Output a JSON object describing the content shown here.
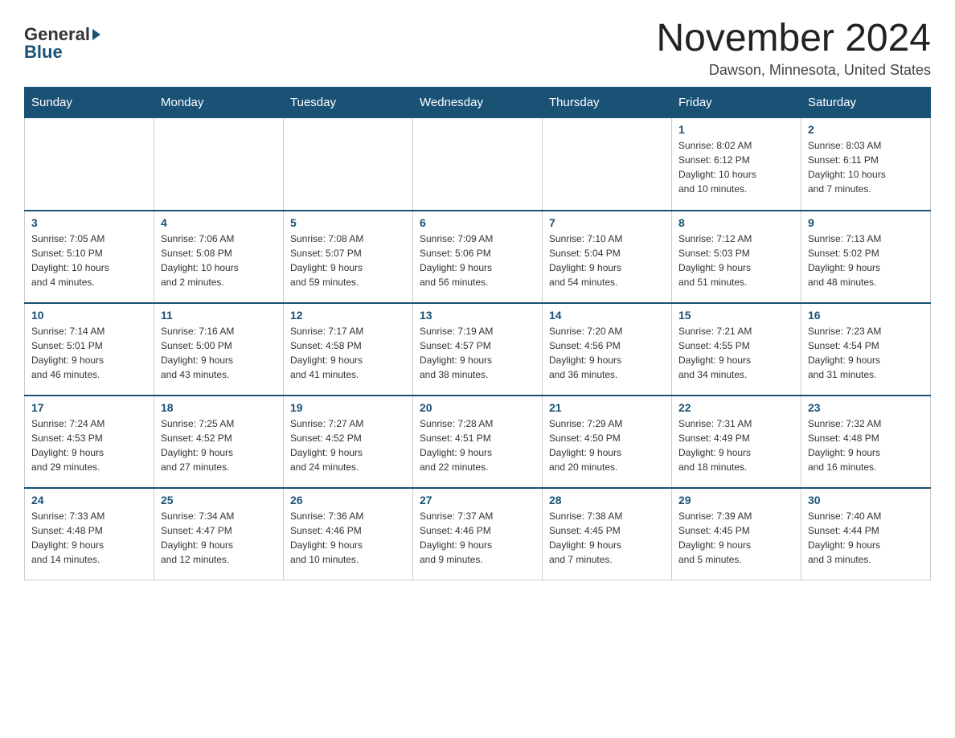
{
  "header": {
    "logo_general": "General",
    "logo_blue": "Blue",
    "month_title": "November 2024",
    "location": "Dawson, Minnesota, United States"
  },
  "days_of_week": [
    "Sunday",
    "Monday",
    "Tuesday",
    "Wednesday",
    "Thursday",
    "Friday",
    "Saturday"
  ],
  "weeks": [
    {
      "days": [
        {
          "number": "",
          "info": ""
        },
        {
          "number": "",
          "info": ""
        },
        {
          "number": "",
          "info": ""
        },
        {
          "number": "",
          "info": ""
        },
        {
          "number": "",
          "info": ""
        },
        {
          "number": "1",
          "info": "Sunrise: 8:02 AM\nSunset: 6:12 PM\nDaylight: 10 hours\nand 10 minutes."
        },
        {
          "number": "2",
          "info": "Sunrise: 8:03 AM\nSunset: 6:11 PM\nDaylight: 10 hours\nand 7 minutes."
        }
      ]
    },
    {
      "days": [
        {
          "number": "3",
          "info": "Sunrise: 7:05 AM\nSunset: 5:10 PM\nDaylight: 10 hours\nand 4 minutes."
        },
        {
          "number": "4",
          "info": "Sunrise: 7:06 AM\nSunset: 5:08 PM\nDaylight: 10 hours\nand 2 minutes."
        },
        {
          "number": "5",
          "info": "Sunrise: 7:08 AM\nSunset: 5:07 PM\nDaylight: 9 hours\nand 59 minutes."
        },
        {
          "number": "6",
          "info": "Sunrise: 7:09 AM\nSunset: 5:06 PM\nDaylight: 9 hours\nand 56 minutes."
        },
        {
          "number": "7",
          "info": "Sunrise: 7:10 AM\nSunset: 5:04 PM\nDaylight: 9 hours\nand 54 minutes."
        },
        {
          "number": "8",
          "info": "Sunrise: 7:12 AM\nSunset: 5:03 PM\nDaylight: 9 hours\nand 51 minutes."
        },
        {
          "number": "9",
          "info": "Sunrise: 7:13 AM\nSunset: 5:02 PM\nDaylight: 9 hours\nand 48 minutes."
        }
      ]
    },
    {
      "days": [
        {
          "number": "10",
          "info": "Sunrise: 7:14 AM\nSunset: 5:01 PM\nDaylight: 9 hours\nand 46 minutes."
        },
        {
          "number": "11",
          "info": "Sunrise: 7:16 AM\nSunset: 5:00 PM\nDaylight: 9 hours\nand 43 minutes."
        },
        {
          "number": "12",
          "info": "Sunrise: 7:17 AM\nSunset: 4:58 PM\nDaylight: 9 hours\nand 41 minutes."
        },
        {
          "number": "13",
          "info": "Sunrise: 7:19 AM\nSunset: 4:57 PM\nDaylight: 9 hours\nand 38 minutes."
        },
        {
          "number": "14",
          "info": "Sunrise: 7:20 AM\nSunset: 4:56 PM\nDaylight: 9 hours\nand 36 minutes."
        },
        {
          "number": "15",
          "info": "Sunrise: 7:21 AM\nSunset: 4:55 PM\nDaylight: 9 hours\nand 34 minutes."
        },
        {
          "number": "16",
          "info": "Sunrise: 7:23 AM\nSunset: 4:54 PM\nDaylight: 9 hours\nand 31 minutes."
        }
      ]
    },
    {
      "days": [
        {
          "number": "17",
          "info": "Sunrise: 7:24 AM\nSunset: 4:53 PM\nDaylight: 9 hours\nand 29 minutes."
        },
        {
          "number": "18",
          "info": "Sunrise: 7:25 AM\nSunset: 4:52 PM\nDaylight: 9 hours\nand 27 minutes."
        },
        {
          "number": "19",
          "info": "Sunrise: 7:27 AM\nSunset: 4:52 PM\nDaylight: 9 hours\nand 24 minutes."
        },
        {
          "number": "20",
          "info": "Sunrise: 7:28 AM\nSunset: 4:51 PM\nDaylight: 9 hours\nand 22 minutes."
        },
        {
          "number": "21",
          "info": "Sunrise: 7:29 AM\nSunset: 4:50 PM\nDaylight: 9 hours\nand 20 minutes."
        },
        {
          "number": "22",
          "info": "Sunrise: 7:31 AM\nSunset: 4:49 PM\nDaylight: 9 hours\nand 18 minutes."
        },
        {
          "number": "23",
          "info": "Sunrise: 7:32 AM\nSunset: 4:48 PM\nDaylight: 9 hours\nand 16 minutes."
        }
      ]
    },
    {
      "days": [
        {
          "number": "24",
          "info": "Sunrise: 7:33 AM\nSunset: 4:48 PM\nDaylight: 9 hours\nand 14 minutes."
        },
        {
          "number": "25",
          "info": "Sunrise: 7:34 AM\nSunset: 4:47 PM\nDaylight: 9 hours\nand 12 minutes."
        },
        {
          "number": "26",
          "info": "Sunrise: 7:36 AM\nSunset: 4:46 PM\nDaylight: 9 hours\nand 10 minutes."
        },
        {
          "number": "27",
          "info": "Sunrise: 7:37 AM\nSunset: 4:46 PM\nDaylight: 9 hours\nand 9 minutes."
        },
        {
          "number": "28",
          "info": "Sunrise: 7:38 AM\nSunset: 4:45 PM\nDaylight: 9 hours\nand 7 minutes."
        },
        {
          "number": "29",
          "info": "Sunrise: 7:39 AM\nSunset: 4:45 PM\nDaylight: 9 hours\nand 5 minutes."
        },
        {
          "number": "30",
          "info": "Sunrise: 7:40 AM\nSunset: 4:44 PM\nDaylight: 9 hours\nand 3 minutes."
        }
      ]
    }
  ]
}
